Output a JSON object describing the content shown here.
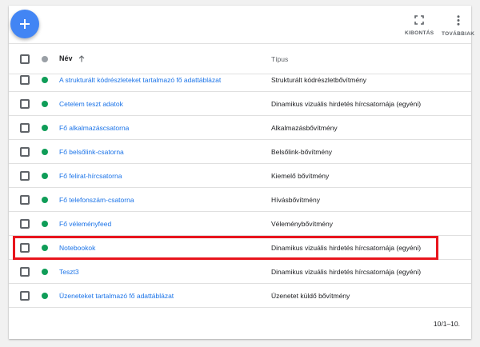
{
  "toolbar": {
    "add_button_icon": "plus-icon",
    "expand_label": "KIBONTÁS",
    "more_label": "TOVÁBBIAK"
  },
  "table": {
    "columns": {
      "name": "Név",
      "type": "Típus"
    },
    "sort": "ascending",
    "rows": [
      {
        "name": "A strukturált kódrészleteket tartalmazó fő adattáblázat",
        "type": "Strukturált kódrészletbővítmény",
        "status": "active"
      },
      {
        "name": "Cetelem teszt adatok",
        "type": "Dinamikus vizuális hirdetés hírcsatornája (egyéni)",
        "status": "active"
      },
      {
        "name": "Fő alkalmazáscsatorna",
        "type": "Alkalmazásbővítmény",
        "status": "active"
      },
      {
        "name": "Fő belsőlink-csatorna",
        "type": "Belsőlink-bővítmény",
        "status": "active"
      },
      {
        "name": "Fő felirat-hírcsatorna",
        "type": "Kiemelő bővítmény",
        "status": "active"
      },
      {
        "name": "Fő telefonszám-csatorna",
        "type": "Hívásbővítmény",
        "status": "active"
      },
      {
        "name": "Fő véleményfeed",
        "type": "Véleménybővítmény",
        "status": "active"
      },
      {
        "name": "Notebookok",
        "type": "Dinamikus vizuális hirdetés hírcsatornája (egyéni)",
        "status": "active"
      },
      {
        "name": "Teszt3",
        "type": "Dinamikus vizuális hirdetés hírcsatornája (egyéni)",
        "status": "active"
      },
      {
        "name": "Üzeneteket tartalmazó fő adattáblázat",
        "type": "Üzenetet küldő bővítmény",
        "status": "active"
      }
    ]
  },
  "footer": {
    "pagination": "10/1–10."
  },
  "colors": {
    "accent": "#4285f4",
    "link": "#1a73e8",
    "status_active": "#0f9d58",
    "highlight": "#e8151d"
  }
}
